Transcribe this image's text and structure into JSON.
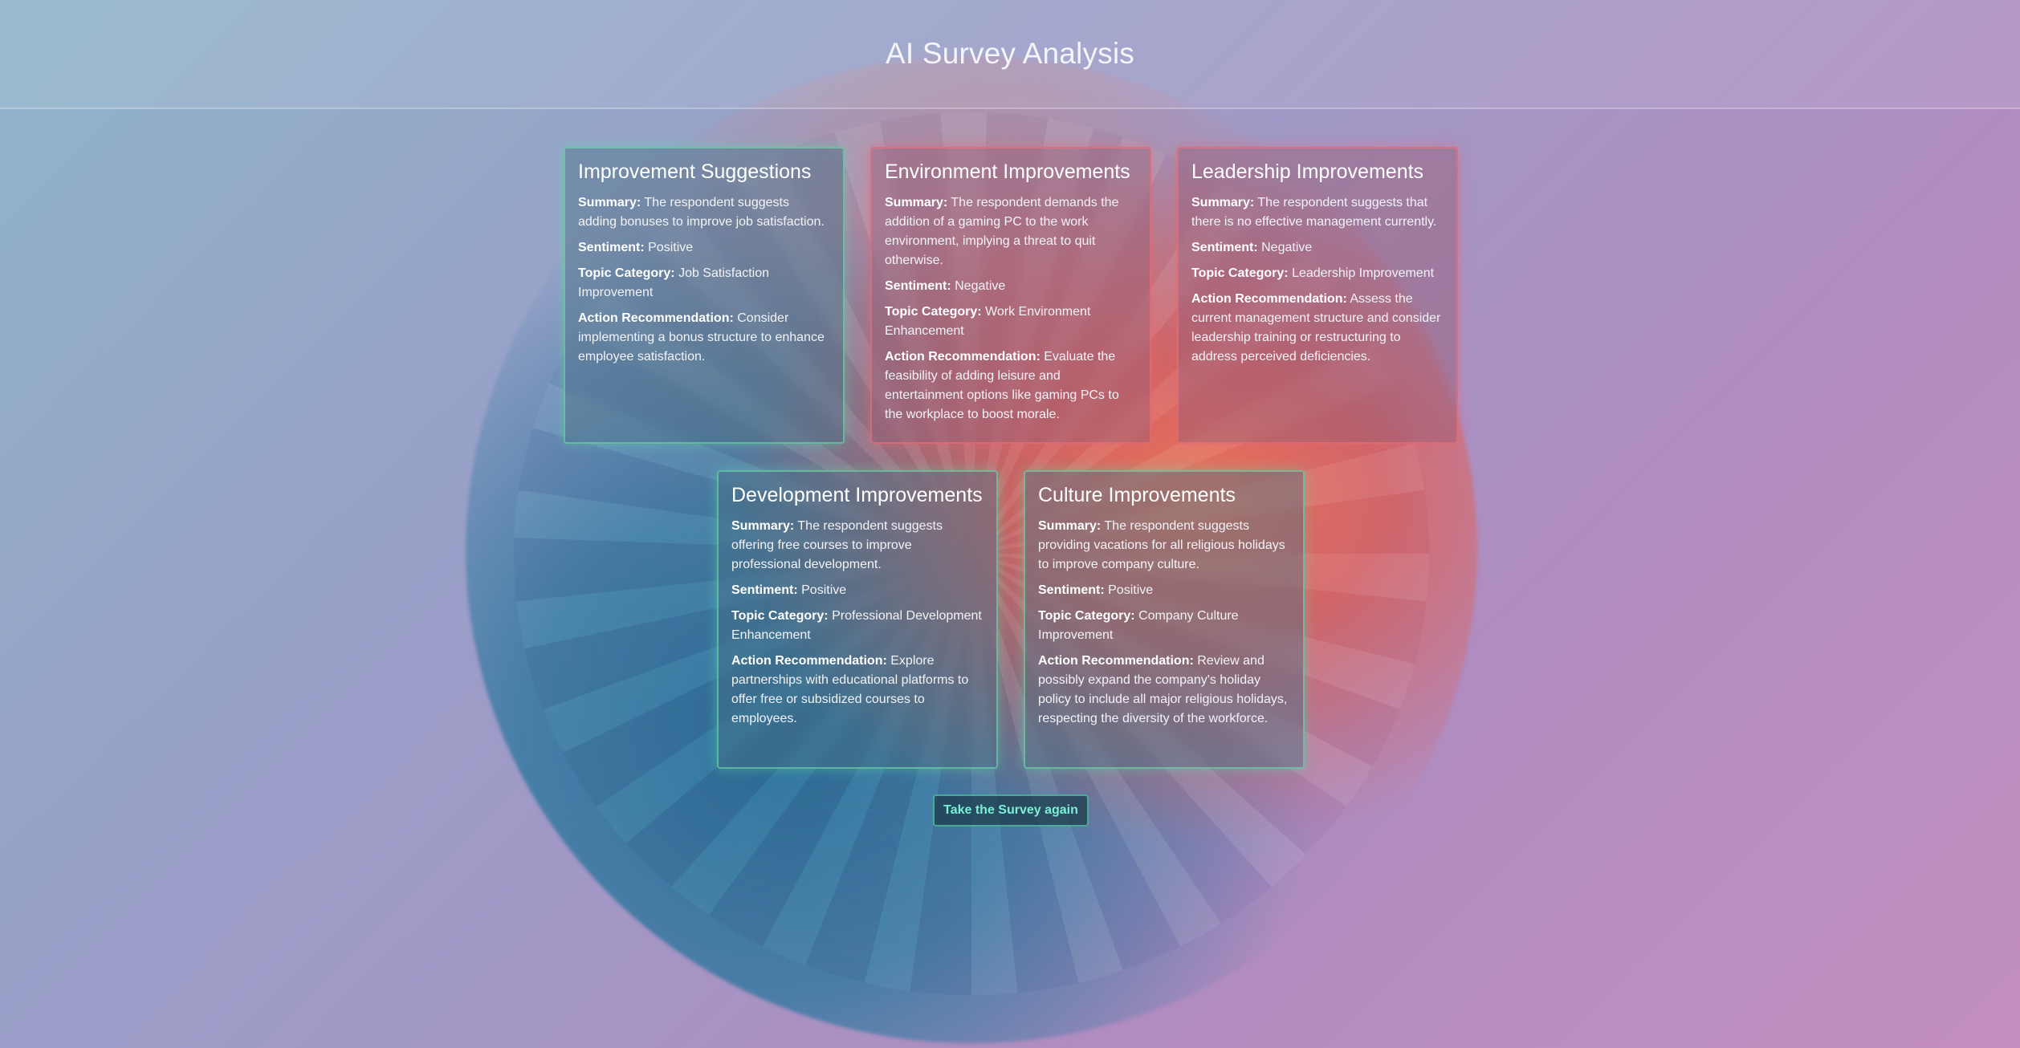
{
  "header": {
    "title": "AI Survey Analysis"
  },
  "labels": {
    "summary": "Summary:",
    "sentiment": "Sentiment:",
    "topic_category": "Topic Category:",
    "action_recommendation": "Action Recommendation:"
  },
  "cards": [
    {
      "title": "Improvement Suggestions",
      "summary": "The respondent suggests adding bonuses to improve job satisfaction.",
      "sentiment": "Positive",
      "topic_category": "Job Satisfaction Improvement",
      "action_recommendation": "Consider implementing a bonus structure to enhance employee satisfaction."
    },
    {
      "title": "Environment Improvements",
      "summary": "The respondent demands the addition of a gaming PC to the work environment, implying a threat to quit otherwise.",
      "sentiment": "Negative",
      "topic_category": "Work Environment Enhancement",
      "action_recommendation": "Evaluate the feasibility of adding leisure and entertainment options like gaming PCs to the workplace to boost morale."
    },
    {
      "title": "Leadership Improvements",
      "summary": "The respondent suggests that there is no effective management currently.",
      "sentiment": "Negative",
      "topic_category": "Leadership Improvement",
      "action_recommendation": "Assess the current management structure and consider leadership training or restructuring to address perceived deficiencies."
    },
    {
      "title": "Development Improvements",
      "summary": "The respondent suggests offering free courses to improve professional development.",
      "sentiment": "Positive",
      "topic_category": "Professional Development Enhancement",
      "action_recommendation": "Explore partnerships with educational platforms to offer free or subsidized courses to employees."
    },
    {
      "title": "Culture Improvements",
      "summary": "The respondent suggests providing vacations for all religious holidays to improve company culture.",
      "sentiment": "Positive",
      "topic_category": "Company Culture Improvement",
      "action_recommendation": "Review and possibly expand the company's holiday policy to include all major religious holidays, respecting the diversity of the workforce."
    }
  ],
  "actions": {
    "retake_label": "Take the Survey again"
  }
}
